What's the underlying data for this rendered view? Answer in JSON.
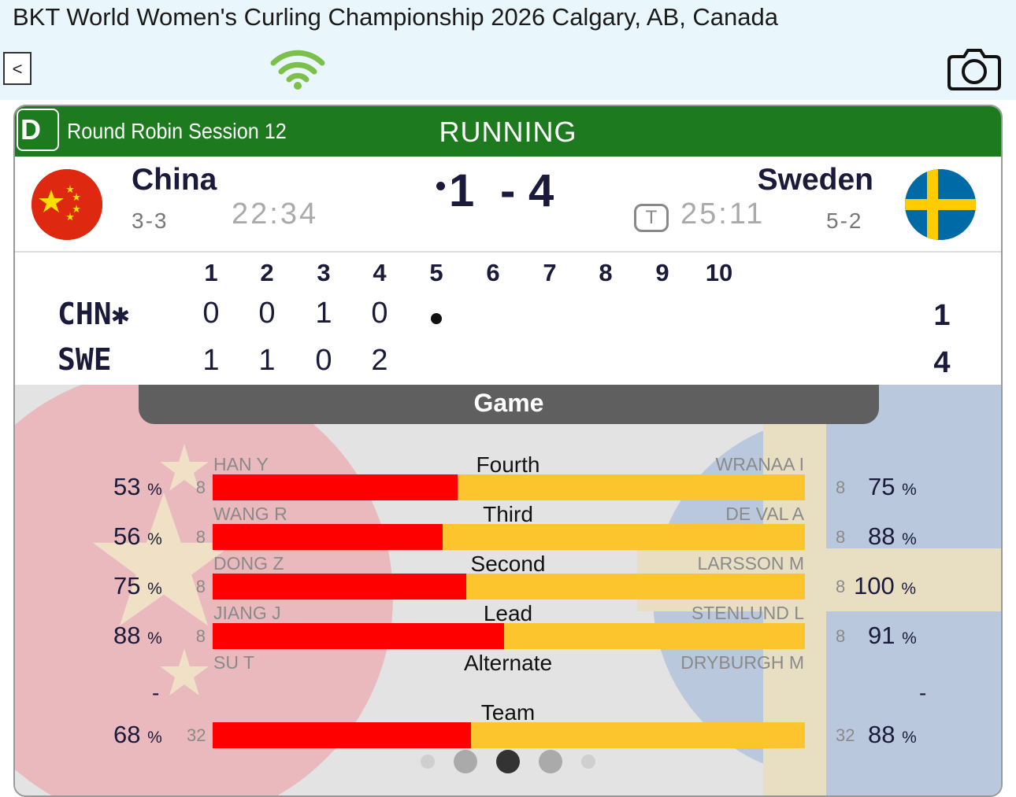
{
  "header": {
    "title": "BKT World Women's Curling Championship 2026 Calgary, AB, Canada",
    "back_label": "<"
  },
  "icons": {
    "back": "chevron-left",
    "connection": "wifi-icon",
    "screenshot": "camera-icon"
  },
  "colors": {
    "status_green": "#1e7a1e",
    "bar_red": "#ff0000",
    "bar_yellow": "#fdc52d",
    "wifi_green": "#7cc04c"
  },
  "game": {
    "draw": "D",
    "session": "Round Robin Session 12",
    "status": "RUNNING",
    "home": {
      "name": "China",
      "record": "3-3",
      "time": "22:34",
      "score": "1",
      "code": "CHN",
      "hammer_mark": "✱",
      "flag": "china-flag"
    },
    "away": {
      "name": "Sweden",
      "record": "5-2",
      "time": "25:11",
      "score": "4",
      "code": "SWE",
      "timeout": "T",
      "flag": "sweden-flag"
    },
    "score_separator": "-"
  },
  "linescore": {
    "ends": [
      "1",
      "2",
      "3",
      "4",
      "5",
      "6",
      "7",
      "8",
      "9",
      "10"
    ],
    "home_ends": [
      "0",
      "0",
      "1",
      "0"
    ],
    "away_ends": [
      "1",
      "1",
      "0",
      "2"
    ],
    "current_end": 5,
    "home_total": "1",
    "away_total": "4"
  },
  "stats": {
    "tab_label": "Game",
    "rows": [
      {
        "position": "Fourth",
        "home_player": "HAN Y",
        "away_player": "WRANAA I",
        "home_shots": "8",
        "away_shots": "8",
        "home_pct": "53",
        "away_pct": "75"
      },
      {
        "position": "Third",
        "home_player": "WANG R",
        "away_player": "DE VAL A",
        "home_shots": "8",
        "away_shots": "8",
        "home_pct": "56",
        "away_pct": "88"
      },
      {
        "position": "Second",
        "home_player": "DONG Z",
        "away_player": "LARSSON M",
        "home_shots": "8",
        "away_shots": "8",
        "home_pct": "75",
        "away_pct": "100"
      },
      {
        "position": "Lead",
        "home_player": "JIANG J",
        "away_player": "STENLUND L",
        "home_shots": "8",
        "away_shots": "8",
        "home_pct": "88",
        "away_pct": "91"
      },
      {
        "position": "Alternate",
        "home_player": "SU T",
        "away_player": "DRYBURGH M",
        "home_dash": "-",
        "away_dash": "-"
      },
      {
        "position": "Team",
        "home_shots": "32",
        "away_shots": "32",
        "home_pct": "68",
        "away_pct": "88"
      }
    ],
    "pct_unit": "%"
  },
  "pager": {
    "pages": 5,
    "active": 2
  }
}
